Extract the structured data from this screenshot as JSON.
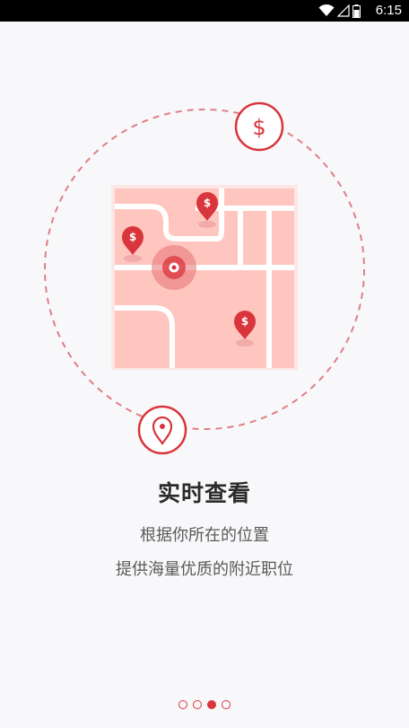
{
  "status_bar": {
    "time": "6:15",
    "wifi_icon": "wifi-icon",
    "signal_icon": "signal-icon",
    "battery_icon": "battery-icon"
  },
  "illustration": {
    "icons": [
      "dollar-circle-icon",
      "location-pin-circle-icon",
      "map-icon",
      "user-location-icon"
    ],
    "price_marker_label": "$",
    "colors": {
      "accent": "#d9353c",
      "map_bg": "#ffc6c0",
      "road": "#ffffff",
      "dash": "#e07f84"
    }
  },
  "content": {
    "title": "实时查看",
    "subtitle_line1": "根据你所在的位置",
    "subtitle_line2": "提供海量优质的附近职位"
  },
  "pager": {
    "count": 4,
    "active_index": 2
  }
}
